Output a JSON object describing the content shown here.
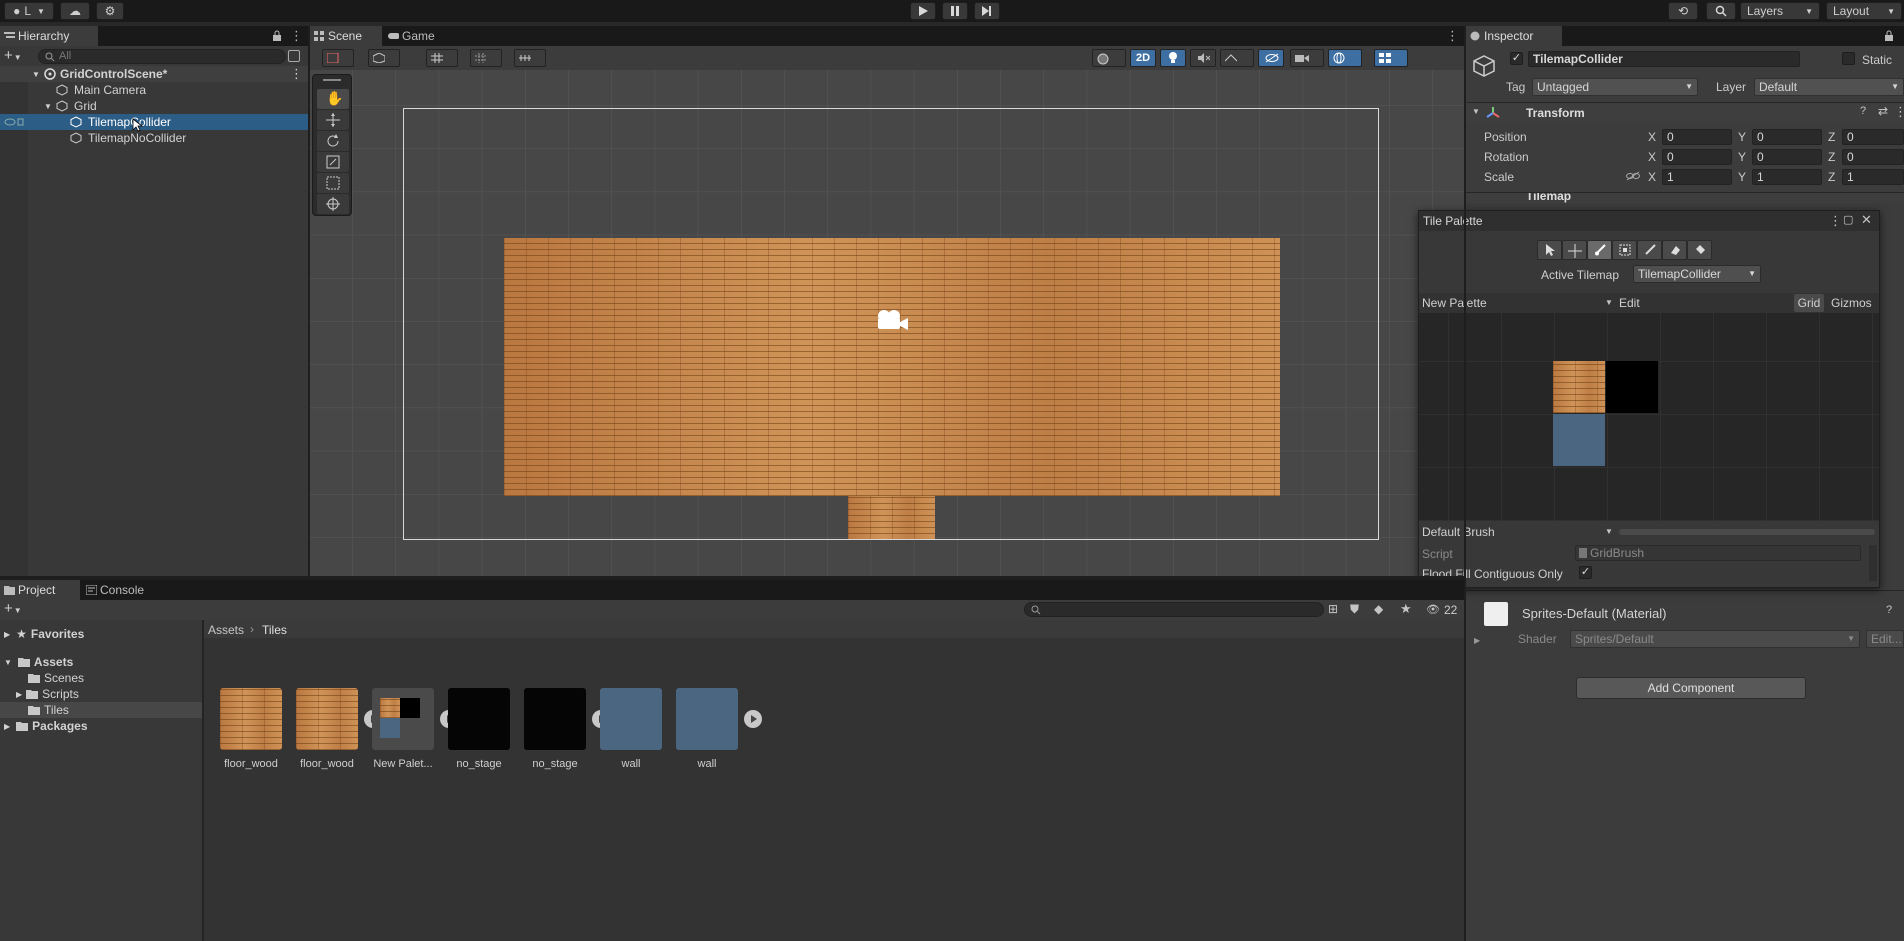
{
  "toolbar": {
    "account_label": "L",
    "layers_label": "Layers",
    "layout_label": "Layout"
  },
  "hierarchy": {
    "tab_label": "Hierarchy",
    "search_placeholder": "All",
    "items": [
      {
        "label": "GridControlScene*"
      },
      {
        "label": "Main Camera"
      },
      {
        "label": "Grid"
      },
      {
        "label": "TilemapCollider"
      },
      {
        "label": "TilemapNoCollider"
      }
    ]
  },
  "scene": {
    "tabs": [
      {
        "label": "Scene"
      },
      {
        "label": "Game"
      }
    ],
    "mode_2d": "2D"
  },
  "inspector": {
    "tab_label": "Inspector",
    "object_name": "TilemapCollider",
    "static_label": "Static",
    "tag_label": "Tag",
    "tag_value": "Untagged",
    "layer_label": "Layer",
    "layer_value": "Default",
    "transform": {
      "title": "Transform",
      "position_label": "Position",
      "rotation_label": "Rotation",
      "scale_label": "Scale",
      "axis_x": "X",
      "axis_y": "Y",
      "axis_z": "Z",
      "position": [
        "0",
        "0",
        "0"
      ],
      "rotation": [
        "0",
        "0",
        "0"
      ],
      "scale": [
        "1",
        "1",
        "1"
      ]
    },
    "tilemap_title": "Tilemap",
    "material": {
      "name": "Sprites-Default (Material)",
      "shader_label": "Shader",
      "shader_value": "Sprites/Default",
      "edit_label": "Edit..."
    },
    "add_component": "Add Component"
  },
  "tile_palette": {
    "title": "Tile Palette",
    "active_tilemap_label": "Active Tilemap",
    "active_tilemap_value": "TilemapCollider",
    "palette_name": "New Palette",
    "edit_label": "Edit",
    "grid_label": "Grid",
    "gizmos_label": "Gizmos",
    "brush_name": "Default Brush",
    "script_label": "Script",
    "script_value": "GridBrush",
    "flood_fill_label": "Flood Fill Contiguous Only"
  },
  "project": {
    "tabs": [
      {
        "label": "Project"
      },
      {
        "label": "Console"
      }
    ],
    "hidden_count": "22",
    "breadcrumb": [
      "Assets",
      "Tiles"
    ],
    "tree": [
      {
        "label": "Favorites"
      },
      {
        "label": "Assets"
      },
      {
        "label": "Scenes"
      },
      {
        "label": "Scripts"
      },
      {
        "label": "Tiles"
      },
      {
        "label": "Packages"
      }
    ],
    "assets": [
      {
        "label": "floor_wood"
      },
      {
        "label": "floor_wood"
      },
      {
        "label": "New Palet..."
      },
      {
        "label": "no_stage"
      },
      {
        "label": "no_stage"
      },
      {
        "label": "wall"
      },
      {
        "label": "wall"
      }
    ]
  },
  "colors": {
    "selection": "#2c5d87",
    "wood": "#c98a4e",
    "wall": "#4a6680",
    "accent_blue": "#3d6fa3"
  }
}
